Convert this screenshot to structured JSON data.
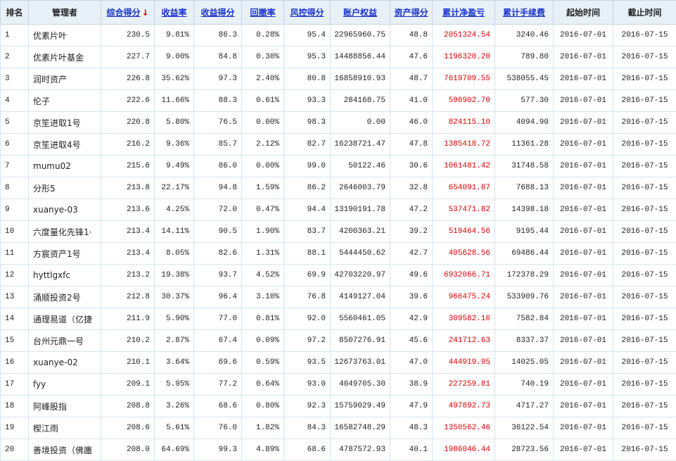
{
  "columns": [
    {
      "key": "rank",
      "label": "排名",
      "link": false
    },
    {
      "key": "manager",
      "label": "管理者",
      "link": false
    },
    {
      "key": "composite",
      "label": "综合得分",
      "link": true,
      "sort_arrow": "↓"
    },
    {
      "key": "return_rate",
      "label": "收益率",
      "link": true
    },
    {
      "key": "return_score",
      "label": "收益得分",
      "link": true
    },
    {
      "key": "drawdown",
      "label": "回撤率",
      "link": true
    },
    {
      "key": "risk_score",
      "label": "风控得分",
      "link": true
    },
    {
      "key": "equity",
      "label": "账户权益",
      "link": true
    },
    {
      "key": "asset_score",
      "label": "资产得分",
      "link": true
    },
    {
      "key": "net_pnl",
      "label": "累计净盈亏",
      "link": true
    },
    {
      "key": "fees",
      "label": "累计手续费",
      "link": true
    },
    {
      "key": "start",
      "label": "起始时间",
      "link": false
    },
    {
      "key": "end",
      "label": "截止时间",
      "link": false
    }
  ],
  "rows": [
    [
      "1",
      "优素片叶",
      "230.5",
      "9.81%",
      "86.3",
      "0.28%",
      "95.4",
      "22965960.75",
      "48.8",
      "2051324.54",
      "3240.46",
      "2016-07-01",
      "2016-07-15"
    ],
    [
      "2",
      "优素片叶基金",
      "227.7",
      "9.00%",
      "84.8",
      "0.30%",
      "95.3",
      "14488856.44",
      "47.6",
      "1196320.20",
      "789.80",
      "2016-07-01",
      "2016-07-15"
    ],
    [
      "3",
      "润时资产",
      "226.8",
      "35.62%",
      "97.3",
      "2.40%",
      "80.8",
      "16858910.93",
      "48.7",
      "7619709.55",
      "538055.45",
      "2016-07-01",
      "2016-07-15"
    ],
    [
      "4",
      "伦子",
      "222.6",
      "11.66%",
      "88.3",
      "0.61%",
      "93.3",
      "284168.75",
      "41.0",
      "596902.70",
      "577.30",
      "2016-07-01",
      "2016-07-15"
    ],
    [
      "5",
      "京笙进取1号",
      "220.8",
      "5.80%",
      "76.5",
      "0.00%",
      "98.3",
      "0.00",
      "46.0",
      "824115.10",
      "4094.90",
      "2016-07-01",
      "2016-07-15"
    ],
    [
      "6",
      "京笙进取4号",
      "216.2",
      "9.36%",
      "85.7",
      "2.12%",
      "82.7",
      "16238721.47",
      "47.8",
      "1385418.72",
      "11361.28",
      "2016-07-01",
      "2016-07-15"
    ],
    [
      "7",
      "mumu02",
      "215.6",
      "9.49%",
      "86.0",
      "0.00%",
      "99.0",
      "50122.46",
      "30.6",
      "1061481.42",
      "31748.58",
      "2016-07-01",
      "2016-07-15"
    ],
    [
      "8",
      "分形5",
      "213.8",
      "22.17%",
      "94.8",
      "1.59%",
      "86.2",
      "2646003.79",
      "32.8",
      "654091.87",
      "7688.13",
      "2016-07-01",
      "2016-07-15"
    ],
    [
      "9",
      "xuanye-03",
      "213.6",
      "4.25%",
      "72.0",
      "0.47%",
      "94.4",
      "13190191.78",
      "47.2",
      "537471.82",
      "14398.18",
      "2016-07-01",
      "2016-07-15"
    ],
    [
      "10",
      "六度量化先锋1·",
      "213.4",
      "14.11%",
      "90.5",
      "1.90%",
      "83.7",
      "4200363.21",
      "39.2",
      "519464.56",
      "9195.44",
      "2016-07-01",
      "2016-07-15"
    ],
    [
      "11",
      "方宸资产1号",
      "213.4",
      "8.05%",
      "82.6",
      "1.31%",
      "88.1",
      "5444450.62",
      "42.7",
      "405628.56",
      "69486.44",
      "2016-07-01",
      "2016-07-15"
    ],
    [
      "12",
      "hyttlgxfc",
      "213.2",
      "19.38%",
      "93.7",
      "4.52%",
      "69.9",
      "42703220.97",
      "49.6",
      "6932066.71",
      "172378.29",
      "2016-07-01",
      "2016-07-15"
    ],
    [
      "13",
      "涌顺投资2号",
      "212.8",
      "30.37%",
      "96.4",
      "3.10%",
      "76.8",
      "4149127.04",
      "39.6",
      "966475.24",
      "533909.76",
      "2016-07-01",
      "2016-07-15"
    ],
    [
      "14",
      "通理易道（亿捷",
      "211.9",
      "5.90%",
      "77.0",
      "0.81%",
      "92.0",
      "5560461.05",
      "42.9",
      "309582.16",
      "7582.84",
      "2016-07-01",
      "2016-07-15"
    ],
    [
      "15",
      "台州元鼎一号",
      "210.2",
      "2.87%",
      "67.4",
      "0.09%",
      "97.2",
      "8507276.91",
      "45.6",
      "241712.63",
      "8337.37",
      "2016-07-01",
      "2016-07-15"
    ],
    [
      "16",
      "xuanye-02",
      "210.1",
      "3.64%",
      "69.6",
      "0.59%",
      "93.5",
      "12673763.01",
      "47.0",
      "444919.95",
      "14025.05",
      "2016-07-01",
      "2016-07-15"
    ],
    [
      "17",
      "fyy",
      "209.1",
      "5.95%",
      "77.2",
      "0.64%",
      "93.0",
      "4049705.30",
      "38.9",
      "227259.81",
      "740.19",
      "2016-07-01",
      "2016-07-15"
    ],
    [
      "18",
      "阿峰股指",
      "208.8",
      "3.26%",
      "68.6",
      "0.80%",
      "92.3",
      "15759029.49",
      "47.9",
      "497892.73",
      "4717.27",
      "2016-07-01",
      "2016-07-15"
    ],
    [
      "19",
      "楔江雨",
      "208.6",
      "5.61%",
      "76.0",
      "1.82%",
      "84.3",
      "16582748.29",
      "48.3",
      "1350562.46",
      "36122.54",
      "2016-07-01",
      "2016-07-15"
    ],
    [
      "20",
      "善境投资（佛廛",
      "208.0",
      "64.69%",
      "99.3",
      "4.89%",
      "68.6",
      "4787572.93",
      "40.1",
      "1986046.44",
      "28723.56",
      "2016-07-01",
      "2016-07-15"
    ]
  ],
  "colors": {
    "header_background": "#e8f0f8",
    "link_color": "#1a33cc",
    "profit_color": "#dd0000",
    "border_color": "#d7e5f2"
  }
}
